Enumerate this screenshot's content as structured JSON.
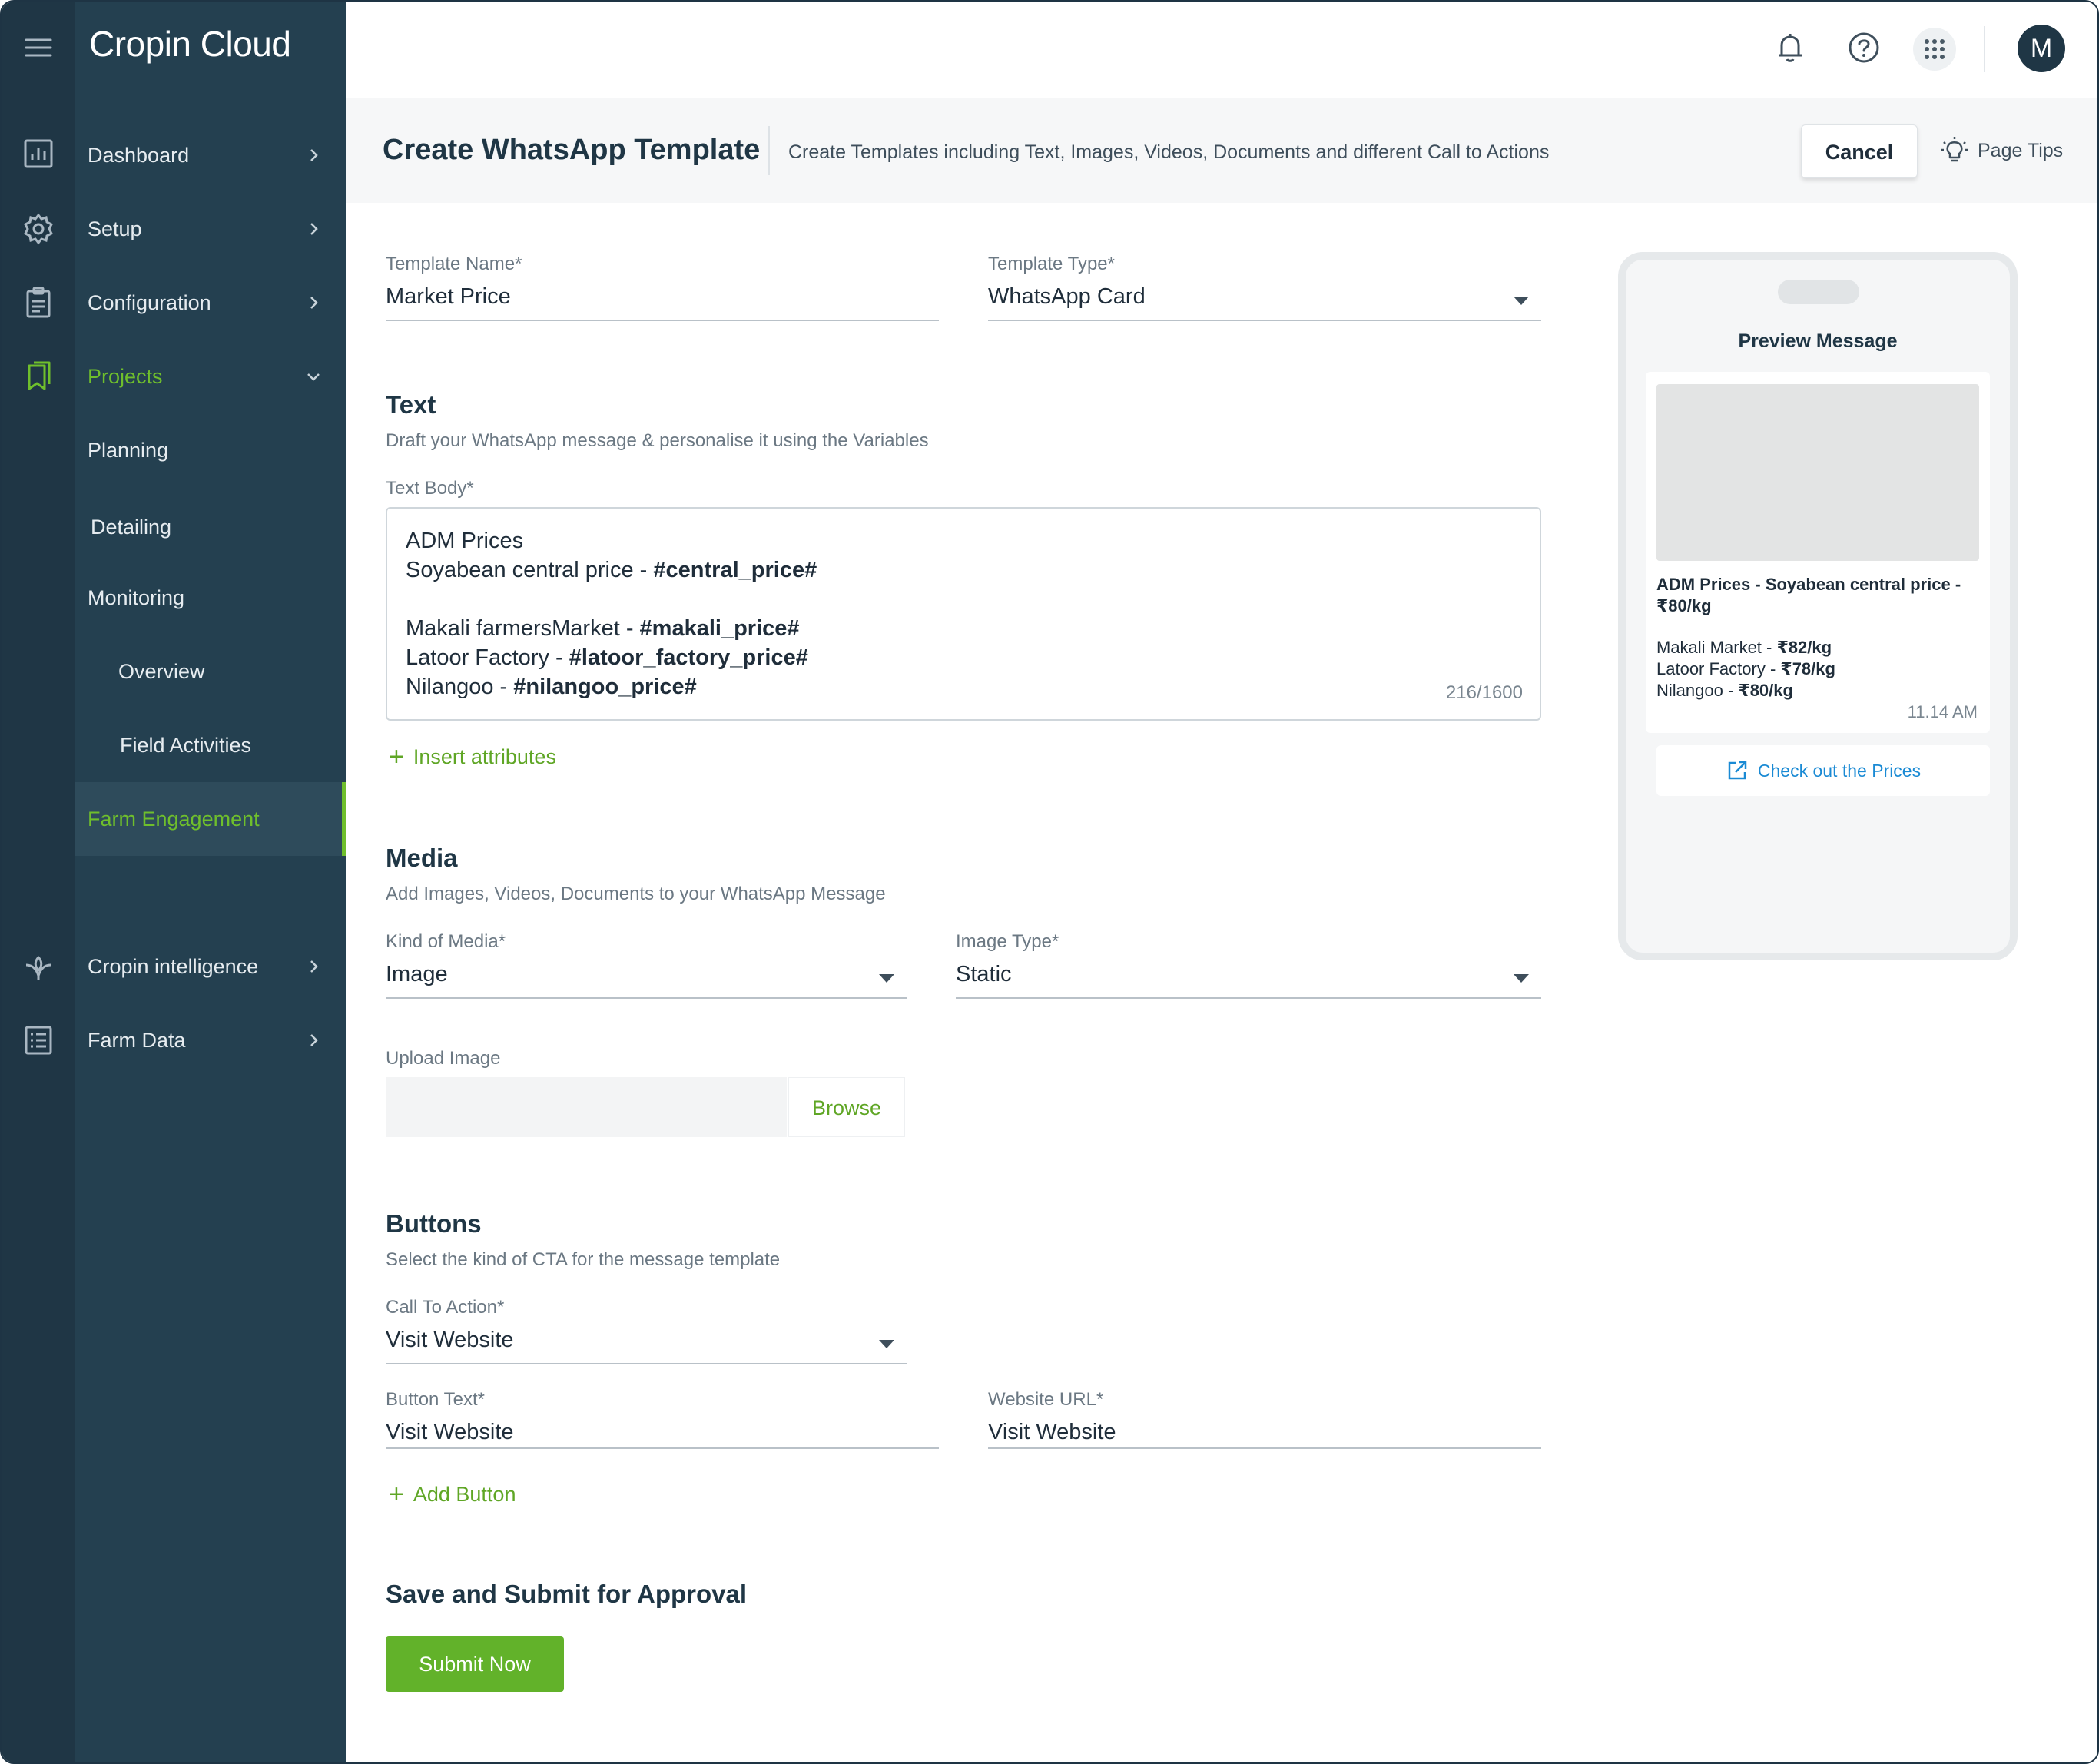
{
  "brand": "Cropin Cloud",
  "header": {
    "avatar_initial": "M"
  },
  "sidebar": {
    "items": [
      {
        "label": "Dashboard"
      },
      {
        "label": "Setup"
      },
      {
        "label": "Configuration"
      },
      {
        "label": "Projects"
      },
      {
        "label": "Planning"
      },
      {
        "label": "Detailing"
      },
      {
        "label": "Monitoring"
      },
      {
        "label": "Overview"
      },
      {
        "label": "Field Activities"
      },
      {
        "label": "Farm Engagement"
      },
      {
        "label": "Cropin intelligence"
      },
      {
        "label": "Farm Data"
      }
    ]
  },
  "page": {
    "title": "Create WhatsApp Template",
    "subtitle": "Create Templates including Text, Images, Videos, Documents and different Call to Actions",
    "cancel_label": "Cancel",
    "tips_label": "Page Tips"
  },
  "form": {
    "template_name_label": "Template Name*",
    "template_name_value": "Market Price",
    "template_type_label": "Template Type*",
    "template_type_value": "WhatsApp Card",
    "text_section_title": "Text",
    "text_section_sub": "Draft your WhatsApp message & personalise it using the Variables",
    "text_body_label": "Text Body*",
    "text_body": {
      "line1": "ADM Prices",
      "line2_plain": "Soyabean central price - ",
      "line2_var": "#central_price#",
      "line3_plain": "Makali farmersMarket - ",
      "line3_var": "#makali_price#",
      "line4_plain": "Latoor Factory - ",
      "line4_var": "#latoor_factory_price#",
      "line5_plain": "Nilangoo - ",
      "line5_var": "#nilangoo_price#"
    },
    "char_counter": "216/1600",
    "insert_attributes_label": "Insert attributes",
    "media_section_title": "Media",
    "media_section_sub": "Add Images, Videos, Documents to your WhatsApp Message",
    "kind_of_media_label": "Kind of Media*",
    "kind_of_media_value": "Image",
    "image_type_label": "Image Type*",
    "image_type_value": "Static",
    "upload_image_label": "Upload Image",
    "browse_label": "Browse",
    "buttons_section_title": "Buttons",
    "buttons_section_sub": "Select the kind of CTA for the message template",
    "cta_label": "Call To Action*",
    "cta_value": "Visit Website",
    "button_text_label": "Button Text*",
    "button_text_value": "Visit Website",
    "website_url_label": "Website URL*",
    "website_url_value": "Visit Website",
    "add_button_label": "Add Button",
    "save_section_title": "Save and Submit for Approval",
    "submit_label": "Submit Now"
  },
  "preview": {
    "title": "Preview Message",
    "heading_line1": "ADM Prices - Soyabean central price -",
    "heading_line2": "₹80/kg",
    "row1_plain": "Makali Market - ",
    "row1_bold": "₹82/kg",
    "row2_plain": "Latoor Factory - ",
    "row2_bold": "₹78/kg",
    "row3_plain": "Nilangoo - ",
    "row3_bold": "₹80/kg",
    "time": "11.14 AM",
    "cta_label": "Check out the Prices"
  },
  "colors": {
    "accent": "#62b22a",
    "sidebar_bg": "#244050",
    "rail_bg": "#1f3645",
    "link_blue": "#1a8ad4"
  }
}
